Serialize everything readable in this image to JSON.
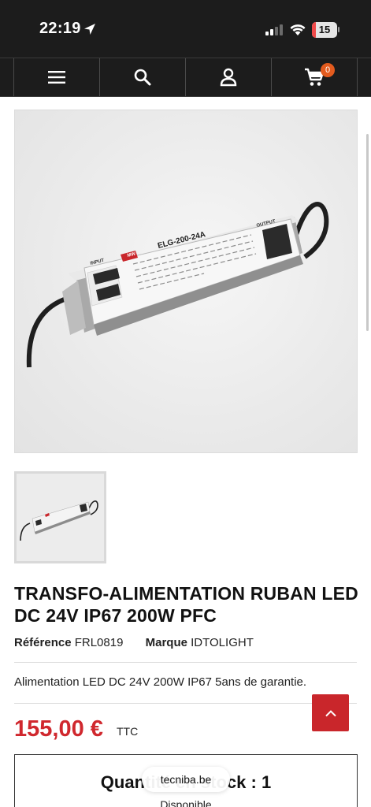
{
  "status_bar": {
    "time": "22:19",
    "battery_level": "15",
    "battery_fraction": 0.15,
    "battery_color": "#f04a4a"
  },
  "navbar": {
    "icons": [
      "menu-icon",
      "search-icon",
      "account-icon",
      "cart-icon"
    ],
    "cart_count": "0",
    "badge_color": "#e35b1e"
  },
  "product_image": {
    "label_model": "ELG-200-24A",
    "label_input": "INPUT",
    "label_output": "OUTPUT",
    "label_brand": "MW"
  },
  "product": {
    "title": "TRANSFO-ALIMENTATION RUBAN LED DC 24V IP67 200W PFC",
    "reference_label": "Référence",
    "reference_value": "FRL0819",
    "brand_label": "Marque",
    "brand_value": "IDTOLIGHT",
    "description": "Alimentation LED DC 24V 200W IP67 5ans de garantie.",
    "price": "155,00 €",
    "price_suffix": "TTC",
    "price_color": "#d0282e"
  },
  "stock": {
    "title": "Quantité en stock : 1",
    "subtitle": "Disponible"
  },
  "browser": {
    "url": "tecniba.be"
  }
}
